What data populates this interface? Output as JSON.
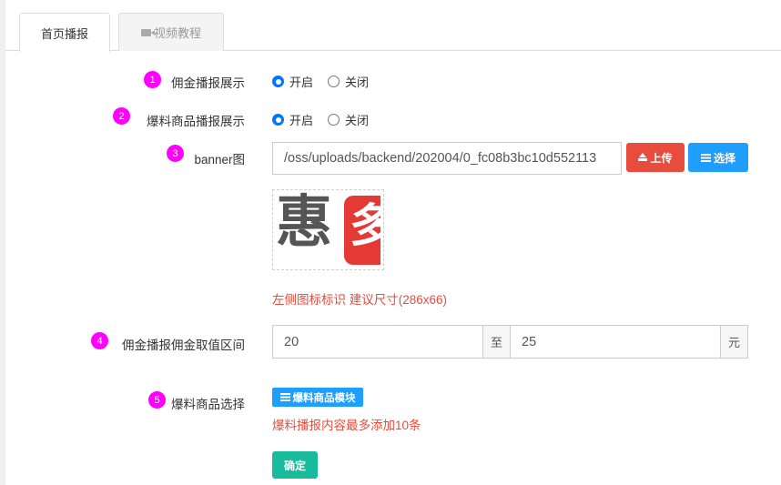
{
  "tabs": [
    {
      "label": "首页播报",
      "active": true
    },
    {
      "label": "视频教程",
      "active": false,
      "icon": "video-camera-icon"
    }
  ],
  "fields": {
    "commission_broadcast": {
      "badge": "1",
      "label": "佣金播报展示",
      "options": [
        "开启",
        "关闭"
      ],
      "selected": "开启"
    },
    "product_broadcast": {
      "badge": "2",
      "label": "爆料商品播报展示",
      "options": [
        "开启",
        "关闭"
      ],
      "selected": "开启"
    },
    "banner": {
      "badge": "3",
      "label": "banner图",
      "value": "/oss/uploads/backend/202004/0_fc08b3bc10d552113",
      "upload_label": "上传",
      "select_label": "选择",
      "hint": "左侧图标标识 建议尺寸(286x66)",
      "thumb_text_left": "惠",
      "thumb_text_right": "多"
    },
    "commission_range": {
      "badge": "4",
      "label": "佣金播报佣金取值区间",
      "min": "20",
      "separator": "至",
      "max": "25",
      "unit": "元"
    },
    "product_select": {
      "badge": "5",
      "label": "爆料商品选择",
      "module_label": "爆料商品模块",
      "hint": "爆料播报内容最多添加10条"
    }
  },
  "submit_label": "确定",
  "colors": {
    "badge": "#ff00ff",
    "primary_blue": "#1e9fff",
    "danger_red": "#e74c3c",
    "success_green": "#18bc9c"
  }
}
